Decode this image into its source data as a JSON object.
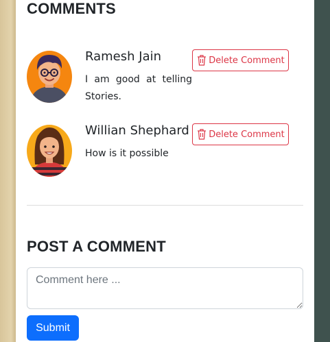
{
  "comments_section": {
    "title": "COMMENTS",
    "items": [
      {
        "author": "Ramesh Jain",
        "text": "I am good at telling Stories.",
        "avatar_icon": "avatar-man-glasses-icon",
        "delete_label": "Delete Comment"
      },
      {
        "author": "Willian Shephard",
        "text": "How is it possible",
        "avatar_icon": "avatar-woman-icon",
        "delete_label": "Delete Comment"
      }
    ]
  },
  "post_section": {
    "title": "POST A COMMENT",
    "input_placeholder": "Comment here ...",
    "input_value": "",
    "submit_label": "Submit"
  },
  "colors": {
    "danger": "#dc3545",
    "primary": "#0d6efd",
    "side_background": "#3f524e",
    "left_strip": "#dfcda3"
  }
}
